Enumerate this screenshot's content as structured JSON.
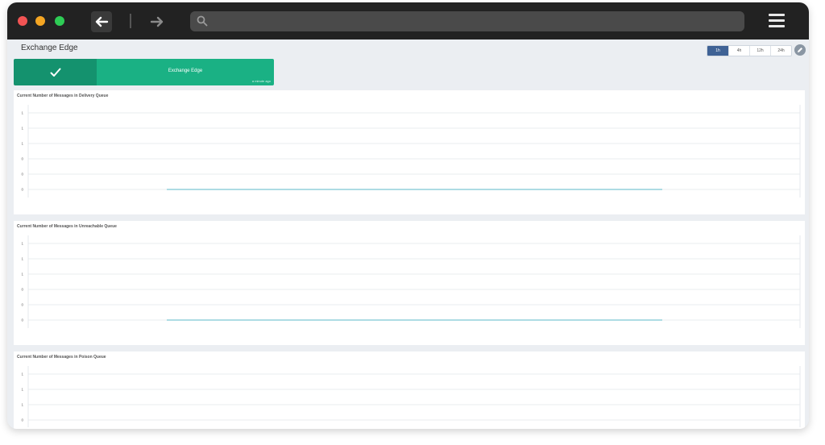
{
  "browser": {
    "back_icon": "arrow-left-icon",
    "forward_icon": "arrow-right-icon",
    "search_icon": "search-icon",
    "menu_icon": "hamburger-menu-icon",
    "url_value": ""
  },
  "page": {
    "title": "Exchange Edge"
  },
  "time_range": {
    "options": [
      "1h",
      "4h",
      "12h",
      "24h"
    ],
    "selected": "1h"
  },
  "status_tile": {
    "icon": "checkmark-icon",
    "name": "Exchange Edge",
    "updated": "a minute ago"
  },
  "colors": {
    "status_dark": "#14926e",
    "status_light": "#1ab184",
    "range_active": "#3f6295",
    "series_line": "#5bb8c9"
  },
  "panels": [
    {
      "title": "Current Number of Messages in Delivery Queue"
    },
    {
      "title": "Current Number of Messages in Unreachable Queue"
    },
    {
      "title": "Current Number of Messages in Poison Queue"
    }
  ],
  "chart_data": [
    {
      "type": "line",
      "title": "Current Number of Messages in Delivery Queue",
      "y_ticks": [
        "1",
        "1",
        "1",
        "0",
        "0",
        "0"
      ],
      "series": [
        {
          "values": [
            0,
            0
          ]
        }
      ],
      "grid": true
    },
    {
      "type": "line",
      "title": "Current Number of Messages in Unreachable Queue",
      "y_ticks": [
        "1",
        "1",
        "1",
        "0",
        "0",
        "0"
      ],
      "series": [
        {
          "values": [
            0,
            0
          ]
        }
      ],
      "grid": true
    },
    {
      "type": "line",
      "title": "Current Number of Messages in Poison Queue",
      "y_ticks": [
        "1",
        "1",
        "1",
        "0"
      ],
      "series": [],
      "grid": true
    }
  ]
}
